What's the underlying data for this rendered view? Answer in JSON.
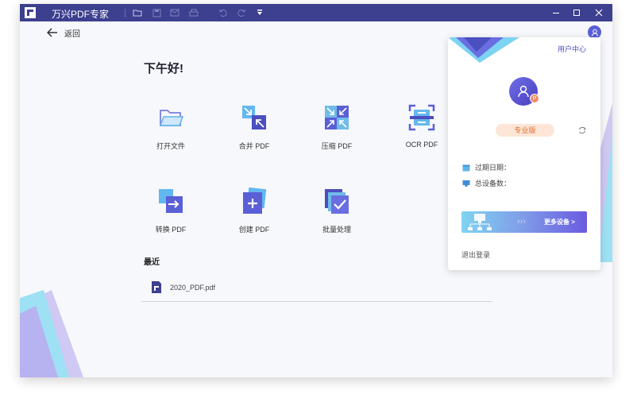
{
  "titlebar": {
    "app_title": "万兴PDF专家",
    "bg_color": "#3d3f8f",
    "toolbar_icons": [
      "folder-icon",
      "save-icon",
      "mail-icon",
      "print-icon",
      "undo-icon",
      "redo-icon",
      "dropdown-arrow-icon"
    ],
    "window_controls": [
      "minimize-icon",
      "maximize-icon",
      "close-icon"
    ]
  },
  "nav": {
    "back_label": "返回"
  },
  "home": {
    "greeting": "下午好!",
    "tools": [
      {
        "label": "打开文件",
        "icon": "open-folder-icon"
      },
      {
        "label": "合并 PDF",
        "icon": "merge-pdf-icon"
      },
      {
        "label": "压缩 PDF",
        "icon": "compress-pdf-icon"
      },
      {
        "label": "OCR PDF",
        "icon": "ocr-pdf-icon"
      },
      {
        "label": "转换 PDF",
        "icon": "convert-pdf-icon"
      },
      {
        "label": "创建 PDF",
        "icon": "create-pdf-icon"
      },
      {
        "label": "批量处理",
        "icon": "batch-process-icon"
      }
    ],
    "recent_title": "最近",
    "recent_files": [
      {
        "name": "2020_PDF.pdf"
      }
    ]
  },
  "popup": {
    "user_center": "用户中心",
    "edition_badge": "专业版",
    "expiry_label": "过期日期：",
    "devices_label": "总设备数：",
    "banner_label": "更多设备 >",
    "logout_label": "退出登录"
  },
  "colors": {
    "accent": "#5b5fd6",
    "badge_text": "#e06b2d",
    "badge_bg": "#fde6d7"
  }
}
